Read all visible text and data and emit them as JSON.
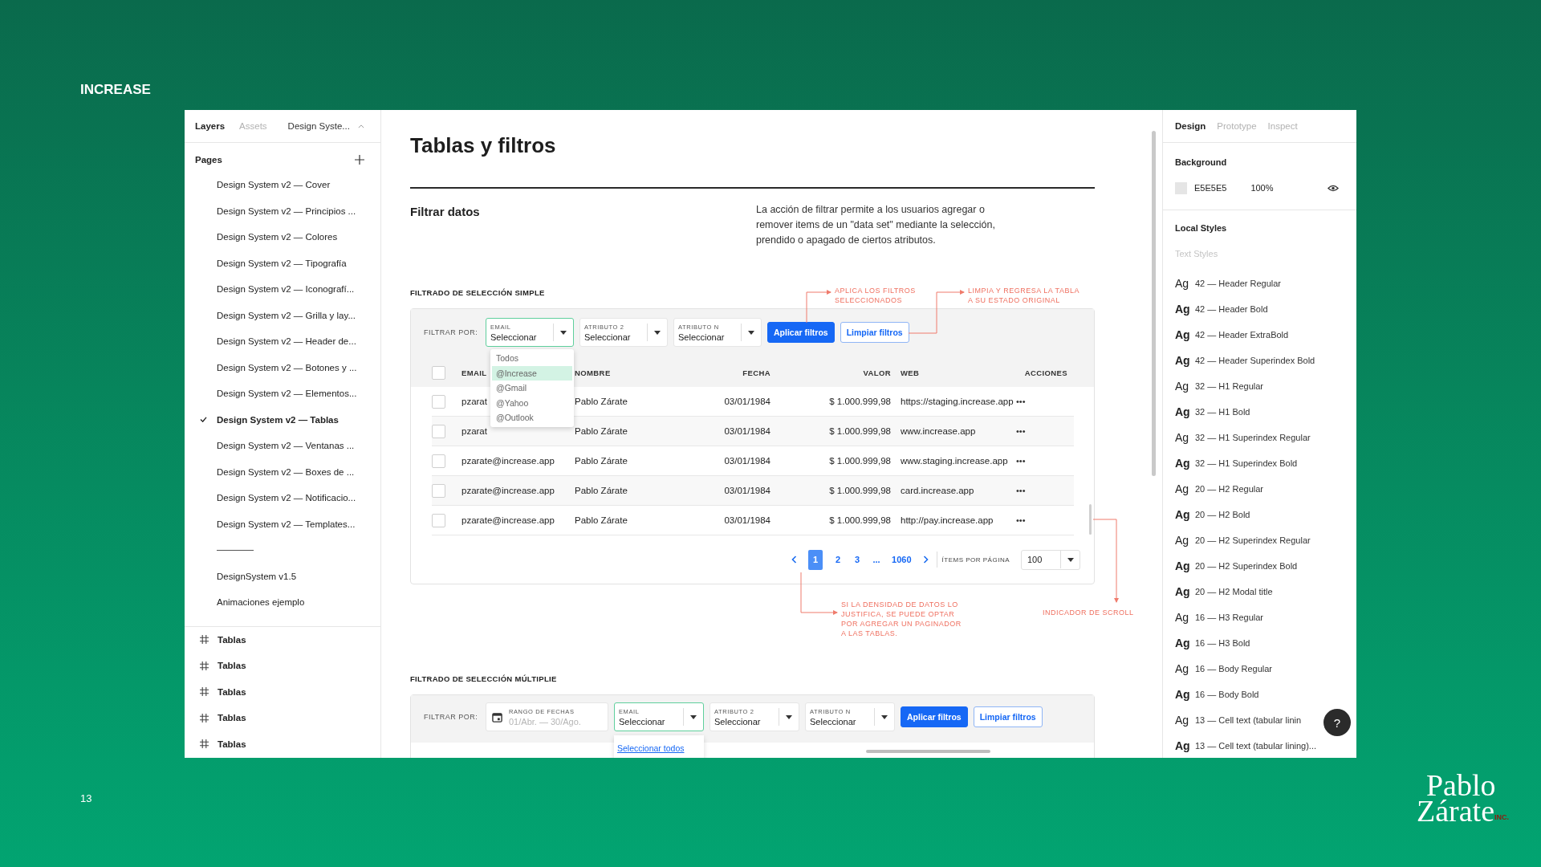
{
  "slide": {
    "brand": "INCREASE",
    "page_number": "13",
    "logo": {
      "line_1": "Pablo",
      "line_2": "Zárate",
      "suffix": "INC."
    }
  },
  "left_panel": {
    "tabs": [
      {
        "label": "Layers",
        "selected": true
      },
      {
        "label": "Assets",
        "selected": false
      }
    ],
    "file_name": "Design Syste...",
    "pages_title": "Pages",
    "pages": [
      {
        "kind": "page",
        "label": "Design System v2 — Cover",
        "selected": false
      },
      {
        "kind": "page",
        "label": "Design System v2 — Principios ...",
        "selected": false
      },
      {
        "kind": "page",
        "label": "Design System v2 — Colores",
        "selected": false
      },
      {
        "kind": "page",
        "label": "Design System v2 — Tipografía",
        "selected": false
      },
      {
        "kind": "page",
        "label": "Design System v2 — Iconografí...",
        "selected": false
      },
      {
        "kind": "page",
        "label": "Design System v2 — Grilla y lay...",
        "selected": false
      },
      {
        "kind": "page",
        "label": "Design System v2 — Header de...",
        "selected": false
      },
      {
        "kind": "page",
        "label": "Design System v2 — Botones y ...",
        "selected": false
      },
      {
        "kind": "page",
        "label": "Design System v2 — Elementos...",
        "selected": false
      },
      {
        "kind": "page",
        "label": "Design System v2 — Tablas",
        "selected": true
      },
      {
        "kind": "page",
        "label": "Design System v2 — Ventanas ...",
        "selected": false
      },
      {
        "kind": "page",
        "label": "Design System v2 — Boxes de ...",
        "selected": false
      },
      {
        "kind": "page",
        "label": "Design System v2 — Notificacio...",
        "selected": false
      },
      {
        "kind": "page",
        "label": "Design System v2 — Templates...",
        "selected": false
      },
      {
        "kind": "divider"
      },
      {
        "kind": "page",
        "label": "DesignSystem v1.5",
        "selected": false
      },
      {
        "kind": "page",
        "label": "Animaciones ejemplo",
        "selected": false
      }
    ],
    "layers": [
      {
        "label": "Tablas"
      },
      {
        "label": "Tablas"
      },
      {
        "label": "Tablas"
      },
      {
        "label": "Tablas"
      },
      {
        "label": "Tablas"
      }
    ]
  },
  "canvas": {
    "title": "Tablas y filtros",
    "section_title": "Filtrar datos",
    "description": "La acción de filtrar permite a los usuarios agregar o remover items de un \"data set\" mediante la selección, prendido o apagado de ciertos atributos.",
    "simple_filter": {
      "label": "FILTRADO DE SELECCIÓN SIMPLE",
      "filter_label": "FILTRAR POR:",
      "filters": [
        {
          "label": "EMAIL",
          "value": "Seleccionar",
          "focused": true
        },
        {
          "label": "ATRIBUTO 2",
          "value": "Seleccionar",
          "focused": false
        },
        {
          "label": "ATRIBUTO N",
          "value": "Seleccionar",
          "focused": false
        }
      ],
      "apply_button": "Aplicar filtros",
      "clear_button": "Limpiar filtros",
      "dropdown": [
        {
          "label": "Todos",
          "selected": false
        },
        {
          "label": "@Increase",
          "selected": true
        },
        {
          "label": "@Gmail",
          "selected": false
        },
        {
          "label": "@Yahoo",
          "selected": false
        },
        {
          "label": "@Outlook",
          "selected": false
        }
      ],
      "table": {
        "select_all_checked": false,
        "columns": [
          "EMAIL",
          "NOMBRE",
          "FECHA",
          "VALOR",
          "WEB",
          "ACCIONES"
        ],
        "rows": [
          {
            "checked": false,
            "email": "pzarat",
            "name": "Pablo Zárate",
            "date": "03/01/1984",
            "value": "$ 1.000.999,98",
            "web": "https://staging.increase.app",
            "actions": "•••"
          },
          {
            "checked": false,
            "email": "pzarat",
            "name": "Pablo Zárate",
            "date": "03/01/1984",
            "value": "$ 1.000.999,98",
            "web": "www.increase.app",
            "actions": "•••"
          },
          {
            "checked": false,
            "email": "pzarate@increase.app",
            "name": "Pablo Zárate",
            "date": "03/01/1984",
            "value": "$ 1.000.999,98",
            "web": "www.staging.increase.app",
            "actions": "•••"
          },
          {
            "checked": false,
            "email": "pzarate@increase.app",
            "name": "Pablo Zárate",
            "date": "03/01/1984",
            "value": "$ 1.000.999,98",
            "web": "card.increase.app",
            "actions": "•••"
          },
          {
            "checked": false,
            "email": "pzarate@increase.app",
            "name": "Pablo Zárate",
            "date": "03/01/1984",
            "value": "$ 1.000.999,98",
            "web": "http://pay.increase.app",
            "actions": "•••"
          }
        ]
      },
      "pagination": {
        "pages": [
          {
            "label": "1",
            "selected": true
          },
          {
            "label": "2",
            "selected": false
          },
          {
            "label": "3",
            "selected": false
          },
          {
            "label": "...",
            "selected": false
          },
          {
            "label": "1060",
            "selected": false
          }
        ],
        "items_label": "ÍTEMS POR PÁGINA",
        "page_size": "100"
      },
      "annotations": [
        {
          "lines": [
            "APLICA LOS FILTROS",
            "SELECCIONADOS"
          ]
        },
        {
          "lines": [
            "LIMPIA Y REGRESA LA TABLA",
            "A SU ESTADO ORIGINAL"
          ]
        },
        {
          "lines": [
            "SI LA DENSIDAD DE DATOS LO",
            "JUSTIFICA, SE PUEDE OPTAR",
            "POR AGREGAR UN PAGINADOR",
            "A LAS TABLAS."
          ]
        },
        {
          "lines": [
            "INDICADOR DE SCROLL"
          ]
        }
      ]
    },
    "multiple_filter": {
      "label": "FILTRADO DE SELECCIÓN MÚLTIPLIE",
      "filter_label": "FILTRAR POR:",
      "date_filter": {
        "label": "RANGO DE FECHAS",
        "placeholder": "01/Abr. — 30/Ago."
      },
      "filters": [
        {
          "label": "EMAIL",
          "value": "Seleccionar",
          "focused": true
        },
        {
          "label": "ATRIBUTO 2",
          "value": "Seleccionar",
          "focused": false
        },
        {
          "label": "ATRIBUTO N",
          "value": "Seleccionar",
          "focused": false
        }
      ],
      "apply_button": "Aplicar filtros",
      "clear_button": "Limpiar filtros",
      "dropdown_link": "Seleccionar todos"
    }
  },
  "right_panel": {
    "tabs": [
      {
        "label": "Design",
        "selected": true
      },
      {
        "label": "Prototype",
        "selected": false
      },
      {
        "label": "Inspect",
        "selected": false
      }
    ],
    "background": {
      "title": "Background",
      "hex": "E5E5E5",
      "opacity": "100%",
      "color": "#e5e5e5"
    },
    "local_styles_title": "Local Styles",
    "text_styles_title": "Text Styles",
    "text_styles": [
      {
        "sample": "Ag",
        "label": "42 — Header Regular",
        "bold": false
      },
      {
        "sample": "Ag",
        "label": "42 — Header Bold",
        "bold": true
      },
      {
        "sample": "Ag",
        "label": "42 — Header ExtraBold",
        "bold": true
      },
      {
        "sample": "Ag",
        "label": "42 — Header Superindex Bold",
        "bold": true
      },
      {
        "sample": "Ag",
        "label": "32 — H1 Regular",
        "bold": false
      },
      {
        "sample": "Ag",
        "label": "32 — H1 Bold",
        "bold": true
      },
      {
        "sample": "Ag",
        "label": "32 — H1 Superindex Regular",
        "bold": false
      },
      {
        "sample": "Ag",
        "label": "32 — H1 Superindex Bold",
        "bold": true
      },
      {
        "sample": "Ag",
        "label": "20 — H2 Regular",
        "bold": false
      },
      {
        "sample": "Ag",
        "label": "20 — H2 Bold",
        "bold": true
      },
      {
        "sample": "Ag",
        "label": "20 — H2 Superindex Regular",
        "bold": false
      },
      {
        "sample": "Ag",
        "label": "20 — H2 Superindex Bold",
        "bold": true
      },
      {
        "sample": "Ag",
        "label": "20 — H2 Modal title",
        "bold": true
      },
      {
        "sample": "Ag",
        "label": "16 — H3 Regular",
        "bold": false
      },
      {
        "sample": "Ag",
        "label": "16 — H3 Bold",
        "bold": true
      },
      {
        "sample": "Ag",
        "label": "16 — Body Regular",
        "bold": false
      },
      {
        "sample": "Ag",
        "label": "16 — Body Bold",
        "bold": true
      },
      {
        "sample": "Ag",
        "label": "13 — Cell text (tabular linin",
        "bold": false
      },
      {
        "sample": "Ag",
        "label": "13 — Cell text (tabular lining)...",
        "bold": true
      }
    ],
    "help_button": "?"
  }
}
